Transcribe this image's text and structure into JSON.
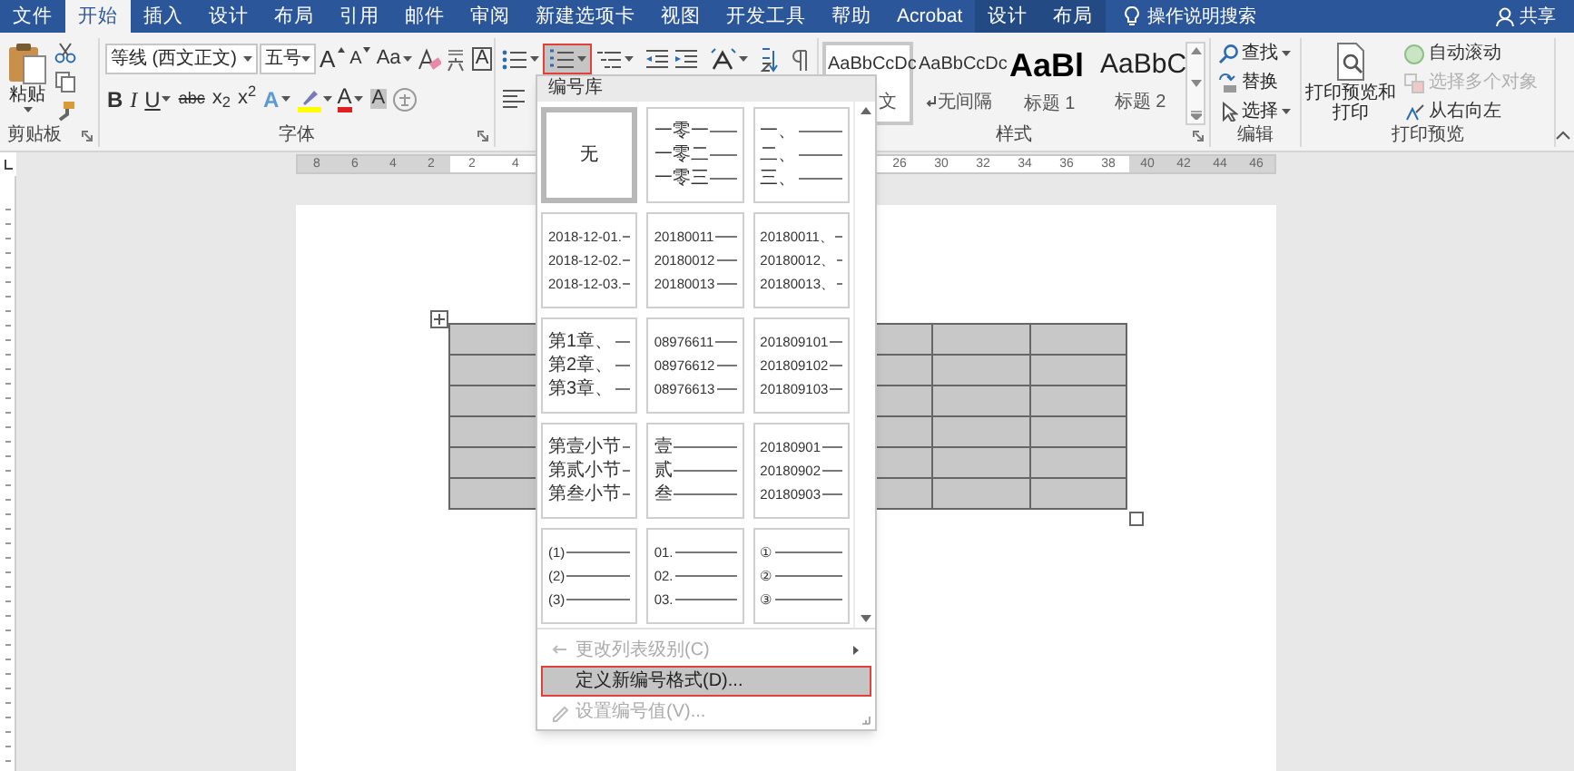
{
  "tabs": [
    {
      "label": "文件",
      "selected": false,
      "contextual": false
    },
    {
      "label": "开始",
      "selected": true,
      "contextual": false
    },
    {
      "label": "插入",
      "selected": false,
      "contextual": false
    },
    {
      "label": "设计",
      "selected": false,
      "contextual": false
    },
    {
      "label": "布局",
      "selected": false,
      "contextual": false
    },
    {
      "label": "引用",
      "selected": false,
      "contextual": false
    },
    {
      "label": "邮件",
      "selected": false,
      "contextual": false
    },
    {
      "label": "审阅",
      "selected": false,
      "contextual": false
    },
    {
      "label": "新建选项卡",
      "selected": false,
      "contextual": false
    },
    {
      "label": "视图",
      "selected": false,
      "contextual": false
    },
    {
      "label": "开发工具",
      "selected": false,
      "contextual": false
    },
    {
      "label": "帮助",
      "selected": false,
      "contextual": false
    },
    {
      "label": "Acrobat",
      "selected": false,
      "contextual": false
    },
    {
      "label": "设计",
      "selected": false,
      "contextual": true
    },
    {
      "label": "布局",
      "selected": false,
      "contextual": true
    }
  ],
  "search": {
    "placeholder": "操作说明搜索"
  },
  "share": {
    "label": "共享"
  },
  "clipboard": {
    "paste": "粘贴",
    "label": "剪贴板"
  },
  "font": {
    "name": "等线 (西文正文)",
    "size": "五号",
    "label": "字体",
    "row1": [
      {
        "kind": "grow",
        "label": "A",
        "dropdown": false
      },
      {
        "kind": "shrink",
        "label": "A",
        "dropdown": false
      },
      {
        "kind": "case",
        "label": "Aa",
        "dropdown": true
      },
      {
        "kind": "clear",
        "dropdown": false
      },
      {
        "kind": "phonetic",
        "dropdown": false
      },
      {
        "kind": "border",
        "label": "A",
        "dropdown": false
      }
    ],
    "row2": [
      {
        "kind": "bold",
        "label": "B",
        "dropdown": false
      },
      {
        "kind": "italic",
        "label": "I",
        "dropdown": false
      },
      {
        "kind": "underline",
        "label": "U",
        "dropdown": true
      },
      {
        "kind": "strike",
        "label": "abc",
        "dropdown": false
      },
      {
        "kind": "subscript",
        "label": "x$_{2}$",
        "dropdown": false
      },
      {
        "kind": "superscript",
        "label": "x$^{2}$",
        "dropdown": false
      },
      {
        "kind": "effects",
        "label": "A",
        "dropdown": true
      },
      {
        "kind": "highlight",
        "dropdown": true
      },
      {
        "kind": "color",
        "label": "A",
        "dropdown": true
      },
      {
        "kind": "shading",
        "label": "A",
        "dropdown": false
      },
      {
        "kind": "enclose",
        "dropdown": false
      }
    ]
  },
  "paragraph": {
    "numbering_open": true
  },
  "styles": {
    "label": "样式",
    "items": [
      {
        "sample": "AaBbCcDc",
        "name": "文",
        "kind": "body",
        "paragraph_mark": false,
        "selected": true
      },
      {
        "sample": "AaBbCcDc",
        "name": "无间隔",
        "kind": "body",
        "paragraph_mark": true,
        "selected": false
      },
      {
        "sample": "AaBl",
        "name": "标题 1",
        "kind": "heading1",
        "paragraph_mark": false,
        "selected": false
      },
      {
        "sample": "AaBbC",
        "name": "标题 2",
        "kind": "heading2",
        "paragraph_mark": false,
        "selected": false
      }
    ]
  },
  "editing": {
    "label": "编辑",
    "items": [
      {
        "kind": "find",
        "label": "查找",
        "dropdown": true
      },
      {
        "kind": "replace",
        "label": "替换",
        "dropdown": false
      },
      {
        "kind": "select",
        "label": "选择",
        "dropdown": true
      }
    ]
  },
  "print": {
    "label": "打印预览",
    "button": "打印预览和打印",
    "items": [
      {
        "kind": "autoscroll",
        "label": "自动滚动",
        "disabled": false
      },
      {
        "kind": "multiselect",
        "label": "选择多个对象",
        "disabled": true
      },
      {
        "kind": "rtl",
        "label": "从右向左",
        "disabled": false
      }
    ]
  },
  "ruler": {
    "segments": [
      [
        "8",
        "6",
        "4",
        "2"
      ],
      [
        "2",
        "4"
      ],
      [
        "26",
        "30",
        "32",
        "34",
        "36",
        "38"
      ],
      [
        "40",
        "42",
        "44",
        "46"
      ]
    ]
  },
  "dropdown": {
    "title": "编号库",
    "tiles": [
      {
        "kind": "none",
        "lines": [
          "无"
        ],
        "selected": true
      },
      {
        "kind": "text",
        "lines": [
          "一零一",
          "一零二",
          "一零三"
        ],
        "selected": false
      },
      {
        "kind": "text",
        "lines": [
          "一、",
          "二、",
          "三、"
        ],
        "selected": false
      },
      {
        "kind": "numeric",
        "lines": [
          "2018-12-01.",
          "2018-12-02.",
          "2018-12-03."
        ],
        "selected": false
      },
      {
        "kind": "numeric",
        "lines": [
          "20180011",
          "20180012",
          "20180013"
        ],
        "selected": false
      },
      {
        "kind": "numeric",
        "lines": [
          "20180011、",
          "20180012、",
          "20180013、"
        ],
        "selected": false
      },
      {
        "kind": "text",
        "lines": [
          "第1章、",
          "第2章、",
          "第3章、"
        ],
        "selected": false
      },
      {
        "kind": "numeric",
        "lines": [
          "08976611",
          "08976612",
          "08976613"
        ],
        "selected": false
      },
      {
        "kind": "numeric",
        "lines": [
          "201809101",
          "201809102",
          "201809103"
        ],
        "selected": false
      },
      {
        "kind": "text",
        "lines": [
          "第壹小节",
          "第贰小节",
          "第叁小节"
        ],
        "selected": false
      },
      {
        "kind": "text",
        "lines": [
          "壹",
          "贰",
          "叁"
        ],
        "selected": false
      },
      {
        "kind": "numeric",
        "lines": [
          "20180901",
          "20180902",
          "20180903"
        ],
        "selected": false
      },
      {
        "kind": "numeric",
        "lines": [
          "(1)",
          "(2)",
          "(3)"
        ],
        "selected": false
      },
      {
        "kind": "numeric",
        "lines": [
          "01.",
          "02.",
          "03."
        ],
        "selected": false
      },
      {
        "kind": "numeric",
        "lines": [
          "①",
          "②",
          "③"
        ],
        "selected": false
      }
    ],
    "menu": [
      {
        "kind": "level",
        "label": "更改列表级别(C)",
        "disabled": true,
        "highlighted": false,
        "submenu": true
      },
      {
        "kind": "define",
        "label": "定义新编号格式(D)...",
        "disabled": false,
        "highlighted": true,
        "submenu": false
      },
      {
        "kind": "value",
        "label": "设置编号值(V)...",
        "disabled": true,
        "highlighted": false,
        "submenu": false
      }
    ]
  }
}
